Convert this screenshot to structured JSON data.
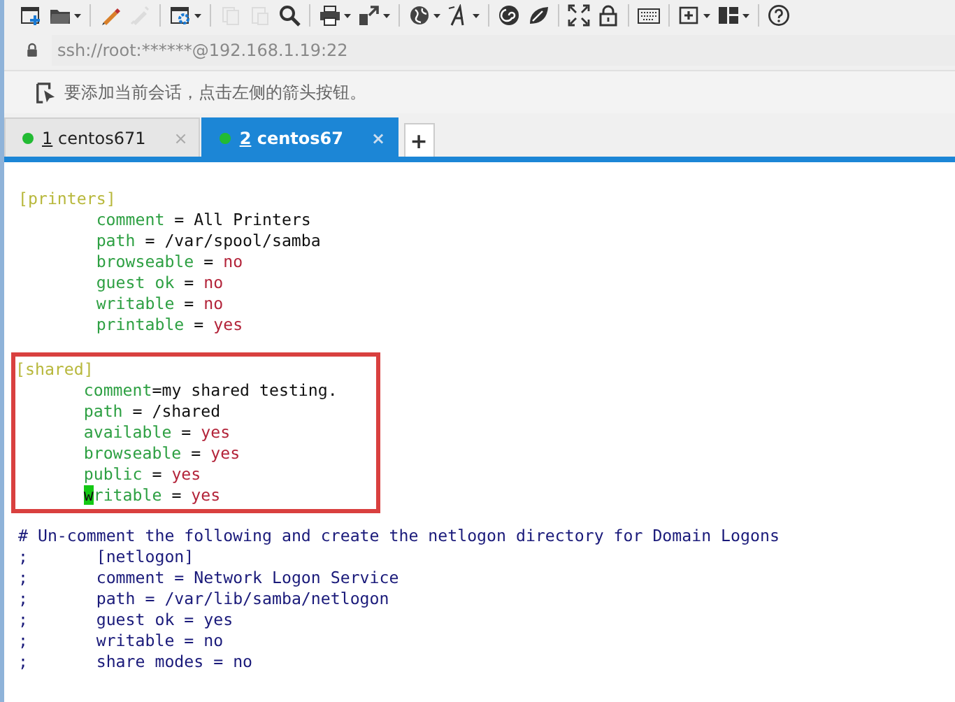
{
  "toolbar": {
    "groups": [
      [
        {
          "dropdown": false,
          "disabled": false
        },
        {
          "dropdown": true,
          "disabled": false
        }
      ],
      [
        {
          "dropdown": false,
          "disabled": false
        },
        {
          "dropdown": false,
          "disabled": true
        }
      ],
      [
        {
          "dropdown": true,
          "disabled": false
        }
      ],
      [
        {
          "dropdown": false,
          "disabled": true
        },
        {
          "dropdown": false,
          "disabled": true
        },
        {
          "dropdown": false,
          "disabled": false
        }
      ],
      [
        {
          "dropdown": true,
          "disabled": false
        },
        {
          "dropdown": true,
          "disabled": false
        }
      ],
      [
        {
          "dropdown": true,
          "disabled": false
        },
        {
          "dropdown": true,
          "disabled": false
        }
      ],
      [
        {
          "dropdown": false,
          "disabled": false
        },
        {
          "dropdown": false,
          "disabled": false
        }
      ],
      [
        {
          "dropdown": false,
          "disabled": false
        },
        {
          "dropdown": false,
          "disabled": false
        }
      ],
      [
        {
          "dropdown": false,
          "disabled": false
        }
      ],
      [
        {
          "dropdown": true,
          "disabled": false
        },
        {
          "dropdown": true,
          "disabled": false
        }
      ],
      [
        {
          "dropdown": false,
          "disabled": false
        }
      ]
    ]
  },
  "address_bar": {
    "value": "ssh://root:******@192.168.1.19:22"
  },
  "hint_bar": {
    "text": "要添加当前会话，点击左侧的箭头按钮。"
  },
  "tabs": [
    {
      "number": "1",
      "name": "centos671",
      "selected": false,
      "color": "#22bb33",
      "close": "×"
    },
    {
      "number": "2",
      "name": "centos67",
      "selected": true,
      "color": "#22bb33",
      "close": "×"
    }
  ],
  "new_tab": "+",
  "terminal": {
    "blocks": [
      {
        "highlighted": false,
        "lines": [
          {
            "kind": "header",
            "segments": [
              {
                "kind": "section",
                "text": "[printers]"
              }
            ]
          },
          {
            "kind": "entry",
            "segments": [
              {
                "kind": "key",
                "text": "comment"
              },
              {
                "kind": "text",
                "text": " = All Printers"
              }
            ]
          },
          {
            "kind": "entry",
            "segments": [
              {
                "kind": "key",
                "text": "path"
              },
              {
                "kind": "text",
                "text": " = /var/spool/samba"
              }
            ]
          },
          {
            "kind": "entry",
            "segments": [
              {
                "kind": "key",
                "text": "browseable"
              },
              {
                "kind": "text",
                "text": " = "
              },
              {
                "kind": "value",
                "text": "no"
              }
            ]
          },
          {
            "kind": "entry",
            "segments": [
              {
                "kind": "key",
                "text": "guest ok"
              },
              {
                "kind": "text",
                "text": " = "
              },
              {
                "kind": "value",
                "text": "no"
              }
            ]
          },
          {
            "kind": "entry",
            "segments": [
              {
                "kind": "key",
                "text": "writable"
              },
              {
                "kind": "text",
                "text": " = "
              },
              {
                "kind": "value",
                "text": "no"
              }
            ]
          },
          {
            "kind": "entry",
            "segments": [
              {
                "kind": "key",
                "text": "printable"
              },
              {
                "kind": "text",
                "text": " = "
              },
              {
                "kind": "value",
                "text": "yes"
              }
            ]
          }
        ]
      },
      {
        "highlighted": true,
        "lines": [
          {
            "kind": "header",
            "segments": [
              {
                "kind": "section",
                "text": "[shared]"
              }
            ]
          },
          {
            "kind": "entry",
            "segments": [
              {
                "kind": "key",
                "text": "comment"
              },
              {
                "kind": "text",
                "text": "=my shared testing."
              }
            ]
          },
          {
            "kind": "entry",
            "segments": [
              {
                "kind": "key",
                "text": "path"
              },
              {
                "kind": "text",
                "text": " = /shared"
              }
            ]
          },
          {
            "kind": "entry",
            "segments": [
              {
                "kind": "key",
                "text": "available"
              },
              {
                "kind": "text",
                "text": " = "
              },
              {
                "kind": "value",
                "text": "yes"
              }
            ]
          },
          {
            "kind": "entry",
            "segments": [
              {
                "kind": "key",
                "text": "browseable"
              },
              {
                "kind": "text",
                "text": " = "
              },
              {
                "kind": "value",
                "text": "yes"
              }
            ]
          },
          {
            "kind": "entry",
            "segments": [
              {
                "kind": "key",
                "text": "public"
              },
              {
                "kind": "text",
                "text": " = "
              },
              {
                "kind": "value",
                "text": "yes"
              }
            ]
          },
          {
            "kind": "entry",
            "segments": [
              {
                "kind": "cursor",
                "text": "w"
              },
              {
                "kind": "key",
                "text": "ritable"
              },
              {
                "kind": "text",
                "text": " = "
              },
              {
                "kind": "value",
                "text": "yes"
              }
            ]
          }
        ]
      },
      {
        "highlighted": false,
        "lines": [
          {
            "kind": "header",
            "segments": [
              {
                "kind": "comment",
                "text": "# Un-comment the following and create the netlogon directory for Domain Logons"
              }
            ]
          },
          {
            "kind": "commented",
            "segments": [
              {
                "kind": "comment",
                "text": ";"
              },
              {
                "kind": "comment",
                "text": "[netlogon]"
              }
            ]
          },
          {
            "kind": "commented",
            "segments": [
              {
                "kind": "comment",
                "text": ";"
              },
              {
                "kind": "comment",
                "text": "comment = Network Logon Service"
              }
            ]
          },
          {
            "kind": "commented",
            "segments": [
              {
                "kind": "comment",
                "text": ";"
              },
              {
                "kind": "comment",
                "text": "path = /var/lib/samba/netlogon"
              }
            ]
          },
          {
            "kind": "commented",
            "segments": [
              {
                "kind": "comment",
                "text": ";"
              },
              {
                "kind": "comment",
                "text": "guest ok = yes"
              }
            ]
          },
          {
            "kind": "commented",
            "segments": [
              {
                "kind": "comment",
                "text": ";"
              },
              {
                "kind": "comment",
                "text": "writable = no"
              }
            ]
          },
          {
            "kind": "commented",
            "segments": [
              {
                "kind": "comment",
                "text": ";"
              },
              {
                "kind": "comment",
                "text": "share modes = no"
              }
            ]
          }
        ]
      }
    ]
  }
}
